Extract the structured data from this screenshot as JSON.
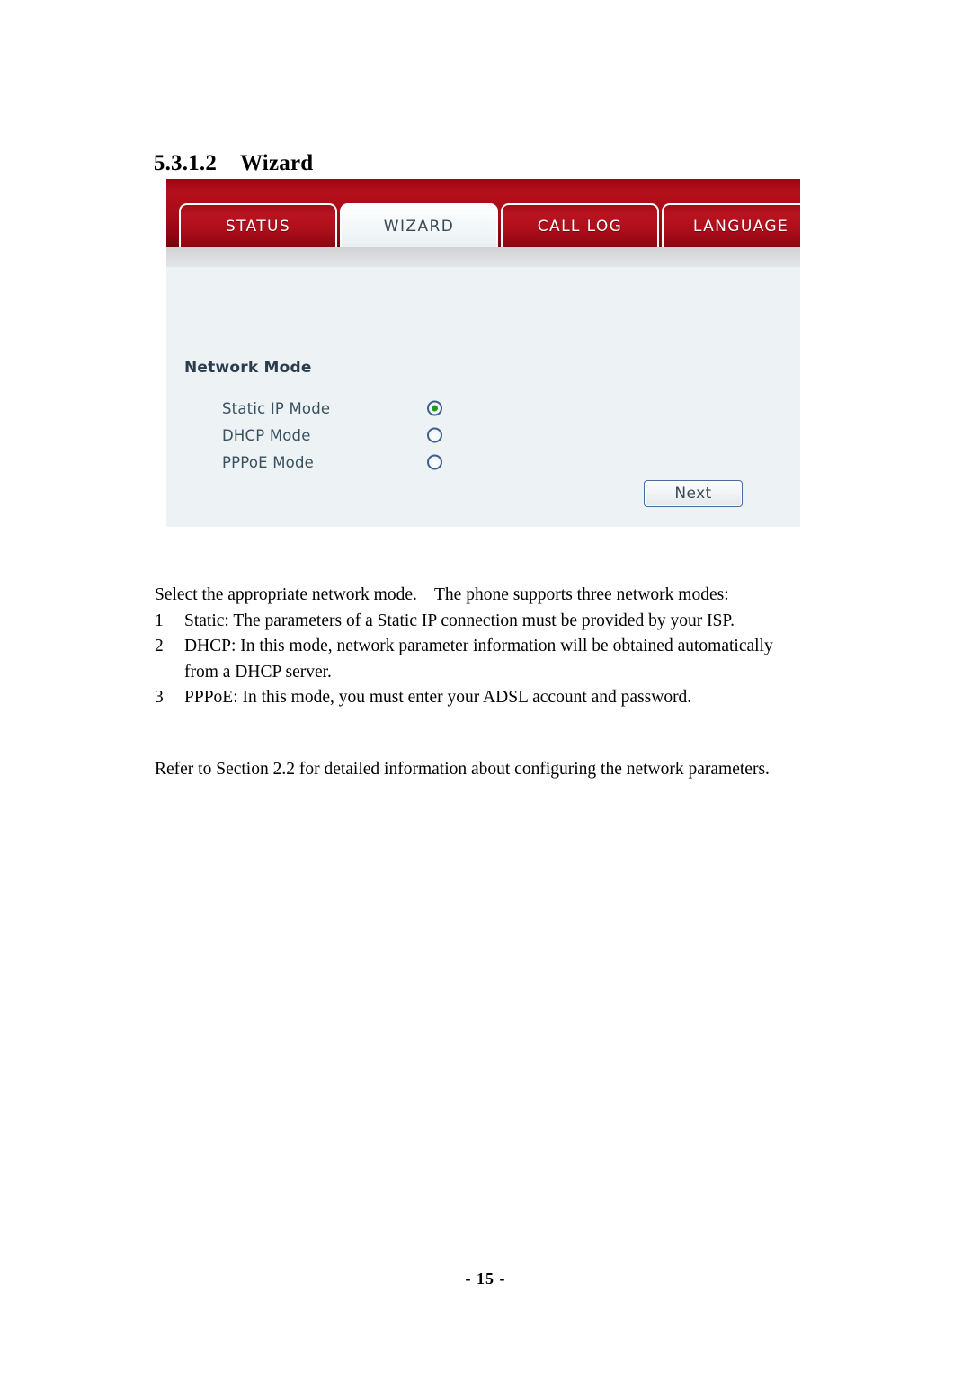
{
  "document": {
    "heading": {
      "number": "5.3.1.2",
      "title": "Wizard"
    },
    "body": {
      "lead": "Select the appropriate network mode.    The phone supports three network modes:",
      "numbered_items": [
        {
          "marker": "1",
          "text": "Static: The parameters of a Static IP connection must be provided by your ISP."
        },
        {
          "marker": "2",
          "text": "DHCP: In this mode, network parameter information will be obtained automatically from a DHCP server."
        },
        {
          "marker": "3",
          "text": "PPPoE: In this mode, you must enter your ADSL account and password."
        }
      ],
      "closing": "Refer to Section 2.2 for detailed information about configuring the network parameters."
    },
    "footer": "- 15 -"
  },
  "screenshot": {
    "tabs": [
      {
        "label": "STATUS",
        "active": false
      },
      {
        "label": "WIZARD",
        "active": true
      },
      {
        "label": "CALL LOG",
        "active": false
      },
      {
        "label": "LANGUAGE",
        "active": false
      }
    ],
    "form": {
      "title": "Network Mode",
      "options": [
        {
          "label": "Static IP Mode",
          "selected": true
        },
        {
          "label": "DHCP Mode",
          "selected": false
        },
        {
          "label": "PPPoE Mode",
          "selected": false
        }
      ],
      "next_button": "Next"
    },
    "colors": {
      "tab_red": "#a70b17",
      "panel_body": "#edf3f5",
      "radio_ring": "#3f5e8c",
      "radio_selected_dot": "#1f9b1f",
      "button_border": "#4a6c9b"
    }
  }
}
